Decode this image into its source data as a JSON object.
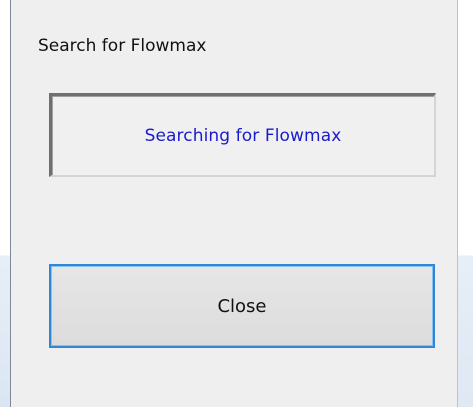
{
  "window": {
    "title": "Search for Flowmax"
  },
  "status": {
    "text": "Searching for Flowmax",
    "text_color": "#1a1acd"
  },
  "buttons": {
    "close_label": "Close",
    "focus_color": "#2f86d6"
  }
}
